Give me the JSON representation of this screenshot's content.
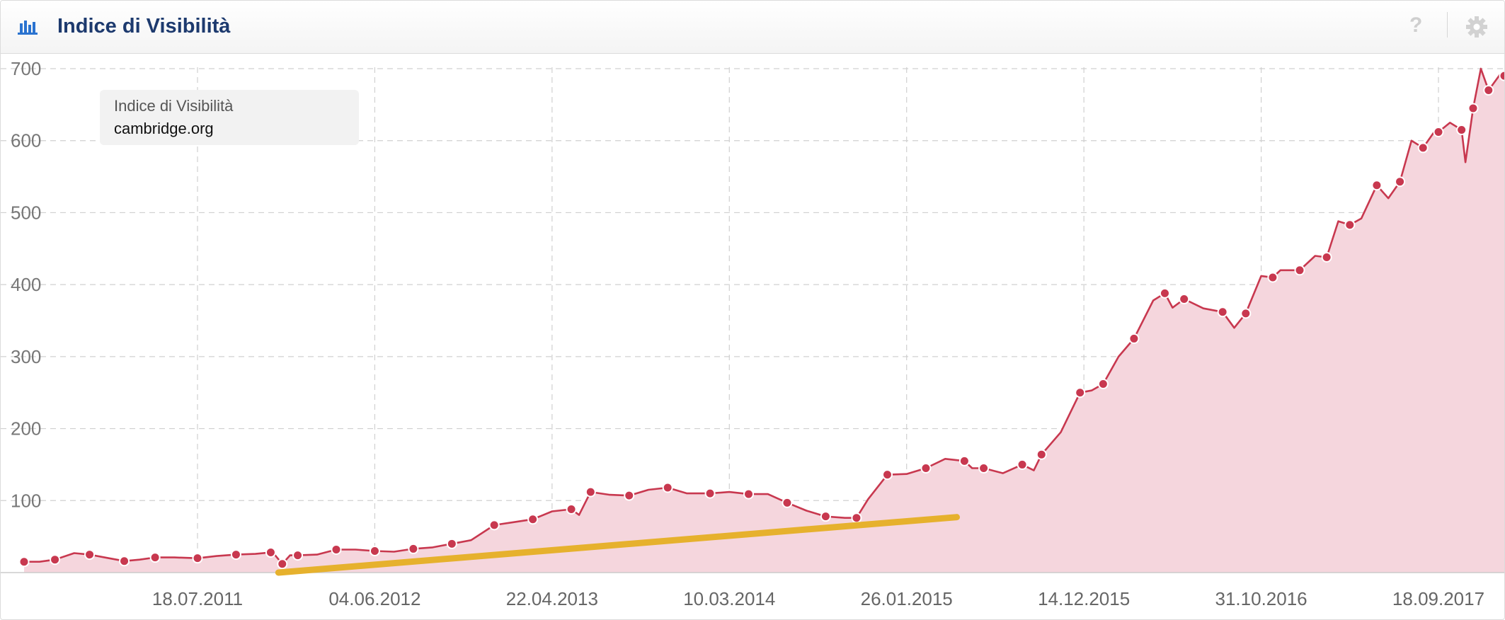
{
  "header": {
    "title": "Indice di Visibilità",
    "chart_icon": "bar-chart-icon",
    "help_icon": "question-icon",
    "settings_icon": "gear-icon"
  },
  "tooltip": {
    "label": "Indice di Visibilità",
    "value": "cambridge.org"
  },
  "colors": {
    "line": "#c8384f",
    "area": "#f5d6dd",
    "trend": "#e6b12d",
    "title": "#1d3a6e",
    "grid": "#d0d0d0"
  },
  "chart_data": {
    "type": "area",
    "title": "Indice di Visibilità",
    "xlabel": "",
    "ylabel": "",
    "ylim": [
      0,
      700
    ],
    "yticks": [
      100,
      200,
      300,
      400,
      500,
      600,
      700
    ],
    "ytick_labels": [
      "100",
      "200",
      "300",
      "400",
      "500",
      "600",
      "700"
    ],
    "xticks": [
      "2011-07-18",
      "2012-06-04",
      "2013-04-22",
      "2014-03-10",
      "2015-01-26",
      "2015-12-14",
      "2016-10-31",
      "2017-09-18"
    ],
    "xtick_labels": [
      "18.07.2011",
      "04.06.2012",
      "22.04.2013",
      "10.03.2014",
      "26.01.2015",
      "14.12.2015",
      "31.10.2016",
      "18.09.2017"
    ],
    "grid": true,
    "series": [
      {
        "name": "cambridge.org",
        "points": [
          [
            "2010-09-06",
            15
          ],
          [
            "2010-10-04",
            15
          ],
          [
            "2010-11-01",
            18
          ],
          [
            "2010-12-06",
            27
          ],
          [
            "2011-01-03",
            25
          ],
          [
            "2011-02-07",
            20
          ],
          [
            "2011-03-07",
            16
          ],
          [
            "2011-04-04",
            18
          ],
          [
            "2011-05-02",
            21
          ],
          [
            "2011-06-06",
            21
          ],
          [
            "2011-07-18",
            20
          ],
          [
            "2011-08-22",
            23
          ],
          [
            "2011-09-26",
            25
          ],
          [
            "2011-10-31",
            26
          ],
          [
            "2011-11-28",
            28
          ],
          [
            "2011-12-05",
            25
          ],
          [
            "2011-12-19",
            12
          ],
          [
            "2012-01-02",
            24
          ],
          [
            "2012-01-16",
            24
          ],
          [
            "2012-02-20",
            25
          ],
          [
            "2012-03-26",
            32
          ],
          [
            "2012-04-30",
            32
          ],
          [
            "2012-06-04",
            30
          ],
          [
            "2012-07-09",
            29
          ],
          [
            "2012-08-13",
            33
          ],
          [
            "2012-09-17",
            35
          ],
          [
            "2012-10-22",
            40
          ],
          [
            "2012-11-26",
            45
          ],
          [
            "2013-01-07",
            66
          ],
          [
            "2013-02-11",
            70
          ],
          [
            "2013-03-18",
            74
          ],
          [
            "2013-04-22",
            85
          ],
          [
            "2013-05-27",
            88
          ],
          [
            "2013-06-10",
            80
          ],
          [
            "2013-07-01",
            112
          ],
          [
            "2013-08-05",
            108
          ],
          [
            "2013-09-09",
            107
          ],
          [
            "2013-10-14",
            115
          ],
          [
            "2013-11-18",
            118
          ],
          [
            "2013-12-23",
            110
          ],
          [
            "2014-02-03",
            110
          ],
          [
            "2014-03-10",
            112
          ],
          [
            "2014-04-14",
            109
          ],
          [
            "2014-05-19",
            109
          ],
          [
            "2014-06-23",
            97
          ],
          [
            "2014-07-28",
            86
          ],
          [
            "2014-09-01",
            78
          ],
          [
            "2014-10-06",
            76
          ],
          [
            "2014-10-27",
            76
          ],
          [
            "2014-11-17",
            102
          ],
          [
            "2014-12-22",
            136
          ],
          [
            "2015-01-26",
            137
          ],
          [
            "2015-03-02",
            145
          ],
          [
            "2015-04-06",
            158
          ],
          [
            "2015-05-11",
            155
          ],
          [
            "2015-05-25",
            145
          ],
          [
            "2015-06-15",
            145
          ],
          [
            "2015-07-20",
            138
          ],
          [
            "2015-08-24",
            150
          ],
          [
            "2015-09-14",
            142
          ],
          [
            "2015-09-28",
            164
          ],
          [
            "2015-11-02",
            195
          ],
          [
            "2015-12-07",
            250
          ],
          [
            "2015-12-28",
            253
          ],
          [
            "2016-01-18",
            262
          ],
          [
            "2016-02-15",
            300
          ],
          [
            "2016-03-14",
            325
          ],
          [
            "2016-04-18",
            378
          ],
          [
            "2016-05-09",
            388
          ],
          [
            "2016-05-23",
            368
          ],
          [
            "2016-06-13",
            380
          ],
          [
            "2016-07-18",
            367
          ],
          [
            "2016-08-22",
            362
          ],
          [
            "2016-09-12",
            340
          ],
          [
            "2016-10-03",
            360
          ],
          [
            "2016-10-31",
            412
          ],
          [
            "2016-11-21",
            410
          ],
          [
            "2016-12-05",
            420
          ],
          [
            "2017-01-09",
            420
          ],
          [
            "2017-02-06",
            440
          ],
          [
            "2017-02-27",
            438
          ],
          [
            "2017-03-20",
            488
          ],
          [
            "2017-04-10",
            483
          ],
          [
            "2017-05-01",
            492
          ],
          [
            "2017-05-29",
            538
          ],
          [
            "2017-06-19",
            520
          ],
          [
            "2017-07-10",
            543
          ],
          [
            "2017-07-31",
            600
          ],
          [
            "2017-08-21",
            590
          ],
          [
            "2017-09-11",
            613
          ],
          [
            "2017-09-18",
            612
          ],
          [
            "2017-10-09",
            625
          ],
          [
            "2017-10-30",
            615
          ],
          [
            "2017-11-06",
            570
          ],
          [
            "2017-11-20",
            645
          ],
          [
            "2017-12-04",
            700
          ],
          [
            "2017-12-18",
            670
          ],
          [
            "2018-01-08",
            692
          ],
          [
            "2018-01-29",
            690
          ]
        ]
      }
    ],
    "trendline": {
      "color": "#e6b12d",
      "start": [
        "2011-12-12",
        0
      ],
      "end": [
        "2015-04-27",
        77
      ]
    }
  }
}
